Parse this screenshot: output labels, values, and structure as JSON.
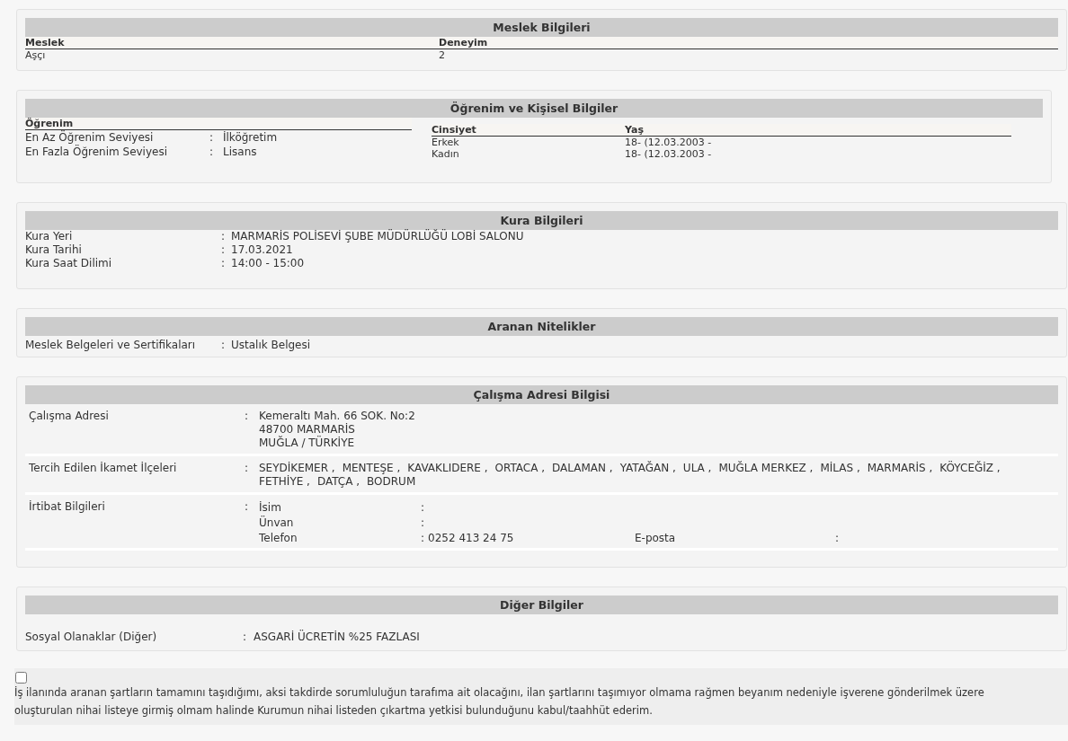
{
  "separator": ":",
  "meslek": {
    "title": "Meslek Bilgileri",
    "columns": [
      "Meslek",
      "Deneyim"
    ],
    "rows": [
      [
        "Aşçı",
        "2"
      ]
    ]
  },
  "ogrenim": {
    "title": "Öğrenim ve Kişisel Bilgiler",
    "heading": "Öğrenim",
    "rows": [
      {
        "label": "En Az Öğrenim Seviyesi",
        "value": "İlköğretim"
      },
      {
        "label": "En Fazla Öğrenim Seviyesi",
        "value": "Lisans"
      }
    ],
    "columns": [
      "Cinsiyet",
      "Yaş"
    ],
    "people": [
      [
        "Erkek",
        "18- (12.03.2003 -"
      ],
      [
        "Kadın",
        "18- (12.03.2003 -"
      ]
    ]
  },
  "kura": {
    "title": "Kura Bilgileri",
    "rows": [
      {
        "label": "Kura Yeri",
        "value": "MARMARİS POLİSEVİ ŞUBE MÜDÜRLÜĞÜ LOBİ SALONU"
      },
      {
        "label": "Kura Tarihi",
        "value": "17.03.2021"
      },
      {
        "label": "Kura Saat Dilimi",
        "value": "14:00 - 15:00"
      }
    ]
  },
  "aranan": {
    "title": "Aranan Nitelikler",
    "rows": [
      {
        "label": "Meslek Belgeleri ve Sertifikaları",
        "value": "Ustalık Belgesi"
      }
    ]
  },
  "adres": {
    "title": "Çalışma Adresi Bilgisi",
    "address": {
      "label": "Çalışma Adresi",
      "lines": [
        "Kemeraltı Mah. 66 SOK. No:2",
        "48700 MARMARİS",
        "MUĞLA / TÜRKİYE"
      ]
    },
    "districts": {
      "label": "Tercih Edilen İkamet İlçeleri",
      "items": [
        "SEYDİKEMER ,",
        "MENTEŞE ,",
        "KAVAKLIDERE ,",
        "ORTACA ,",
        "DALAMAN ,",
        "YATAĞAN ,",
        "ULA ,",
        "MUĞLA MERKEZ ,",
        "MİLAS ,",
        "MARMARİS ,",
        "KÖYCEĞİZ ,",
        "FETHİYE ,",
        "DATÇA ,",
        "BODRUM"
      ]
    },
    "contact": {
      "label": "İrtibat Bilgileri",
      "rows": [
        [
          {
            "label": "İsim"
          }
        ],
        [
          {
            "label": "Ünvan"
          }
        ],
        [
          {
            "label": "Telefon",
            "value": "0252 413 24 75"
          },
          {
            "label": "E-posta"
          }
        ]
      ]
    }
  },
  "diger": {
    "title": "Diğer Bilgiler",
    "rows": [
      {
        "label": "Sosyal Olanaklar (Diğer)",
        "value": "ASGARİ ÜCRETİN %25 FAZLASI"
      }
    ]
  },
  "consent": {
    "checked": false,
    "text": "İş ilanında aranan şartların tamamını taşıdığımı, aksi takdirde sorumluluğun tarafıma ait olacağını, ilan şartlarını taşımıyor olmama rağmen beyanım nedeniyle işverene gönderilmek üzere oluşturulan nihai listeye girmiş olmam halinde Kurumun nihai listeden çıkartma yetkisi bulunduğunu kabul/taahhüt ederim."
  }
}
